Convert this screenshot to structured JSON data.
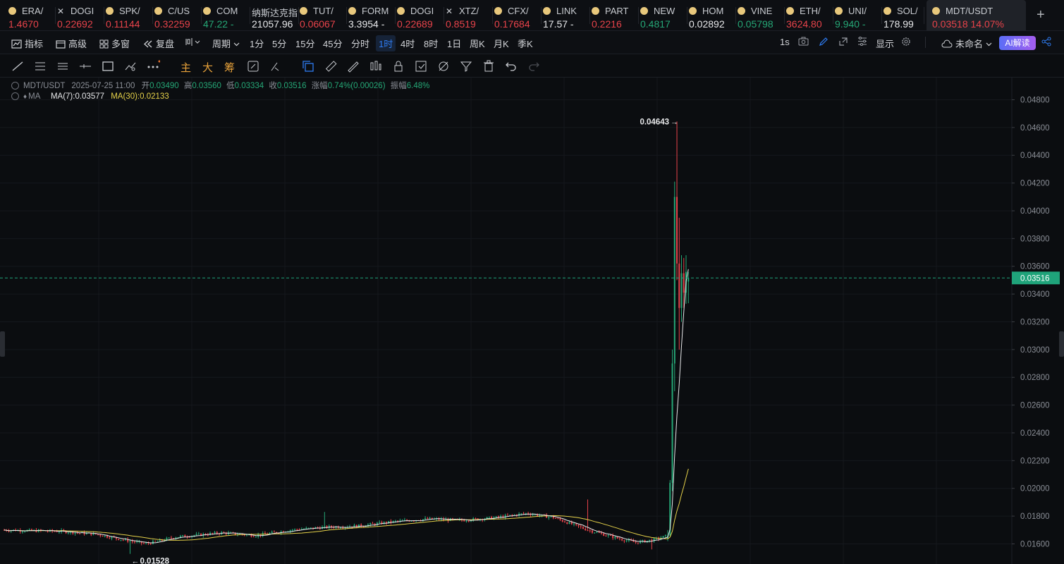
{
  "tickers": [
    {
      "sym": "ERA/",
      "price": "1.4670",
      "cls": "dn",
      "icon": "dot"
    },
    {
      "sym": "DOGI",
      "price": "0.22692",
      "cls": "dn",
      "icon": "x"
    },
    {
      "sym": "SPK/",
      "price": "0.11144",
      "cls": "dn",
      "icon": "dot"
    },
    {
      "sym": "C/US",
      "price": "0.32259",
      "cls": "dn",
      "icon": "dot"
    },
    {
      "sym": "COM",
      "price": "47.22 -",
      "cls": "up",
      "icon": "dot"
    },
    {
      "sym": "纳斯达克指",
      "price": "21057.96",
      "cls": "wh",
      "icon": "none"
    },
    {
      "sym": "TUT/",
      "price": "0.06067",
      "cls": "dn",
      "icon": "dot"
    },
    {
      "sym": "FORM",
      "price": "3.3954 -",
      "cls": "wh",
      "icon": "dot"
    },
    {
      "sym": "DOGI",
      "price": "0.22689",
      "cls": "dn",
      "icon": "dot"
    },
    {
      "sym": "XTZ/",
      "price": "0.8519",
      "cls": "dn",
      "icon": "x"
    },
    {
      "sym": "CFX/",
      "price": "0.17684",
      "cls": "dn",
      "icon": "dot"
    },
    {
      "sym": "LINK",
      "price": "17.57 -",
      "cls": "wh",
      "icon": "dot"
    },
    {
      "sym": "PART",
      "price": "0.2216",
      "cls": "dn",
      "icon": "dot"
    },
    {
      "sym": "NEW",
      "price": "0.4817",
      "cls": "up",
      "icon": "dot"
    },
    {
      "sym": "HOM",
      "price": "0.02892",
      "cls": "wh",
      "icon": "dot"
    },
    {
      "sym": "VINE",
      "price": "0.05798",
      "cls": "up",
      "icon": "dot"
    },
    {
      "sym": "ETH/",
      "price": "3624.80",
      "cls": "dn",
      "icon": "dot"
    },
    {
      "sym": "UNI/",
      "price": "9.940 -",
      "cls": "up",
      "icon": "dot"
    },
    {
      "sym": "SOL/",
      "price": "178.99",
      "cls": "wh",
      "icon": "dot"
    },
    {
      "sym": "MDT/USDT",
      "price": "0.03518  14.07%",
      "cls": "dn",
      "icon": "dot",
      "active": true
    }
  ],
  "toolbar": {
    "indicators": "指标",
    "advanced": "高级",
    "multi_window": "多窗",
    "replay": "复盘",
    "period": "周期",
    "intervals": [
      "1分",
      "5分",
      "15分",
      "45分",
      "分时",
      "1时",
      "4时",
      "8时",
      "1日",
      "周K",
      "月K",
      "季K"
    ],
    "selected_interval": "1时",
    "speed": "1s",
    "display": "显示",
    "unnamed": "未命名",
    "ai": "AI解读"
  },
  "tools2": {
    "main": "主",
    "big": "大",
    "chip": "筹"
  },
  "info": {
    "pair": "MDT/USDT",
    "time": "2025-07-25 11:00",
    "open_label": "开",
    "open": "0.03490",
    "high_label": "高",
    "high": "0.03560",
    "low_label": "低",
    "low": "0.03334",
    "close_label": "收",
    "close": "0.03516",
    "change_label": "涨幅",
    "change": "0.74%(0.00026)",
    "amp_label": "振幅",
    "amp": "6.48%",
    "ma_label": "MA",
    "ma7": "MA(7):0.03577",
    "ma30": "MA(30):0.02133"
  },
  "chart_data": {
    "type": "candlestick",
    "y_ticks": [
      "0.04800",
      "0.04600",
      "0.04400",
      "0.04200",
      "0.04000",
      "0.03800",
      "0.03600",
      "0.03400",
      "0.03200",
      "0.03000",
      "0.02800",
      "0.02600",
      "0.02400",
      "0.02200",
      "0.02000",
      "0.01800",
      "0.01600"
    ],
    "ylim": [
      0.01455,
      0.0496
    ],
    "current_price": "0.03516",
    "high_marker": "0.04643",
    "low_marker": "0.01528",
    "colors": {
      "up": "#25a776",
      "down": "#e8434a",
      "ma7": "#e8e9eb",
      "ma30": "#e6d24a",
      "current": "#1fa37a"
    }
  }
}
